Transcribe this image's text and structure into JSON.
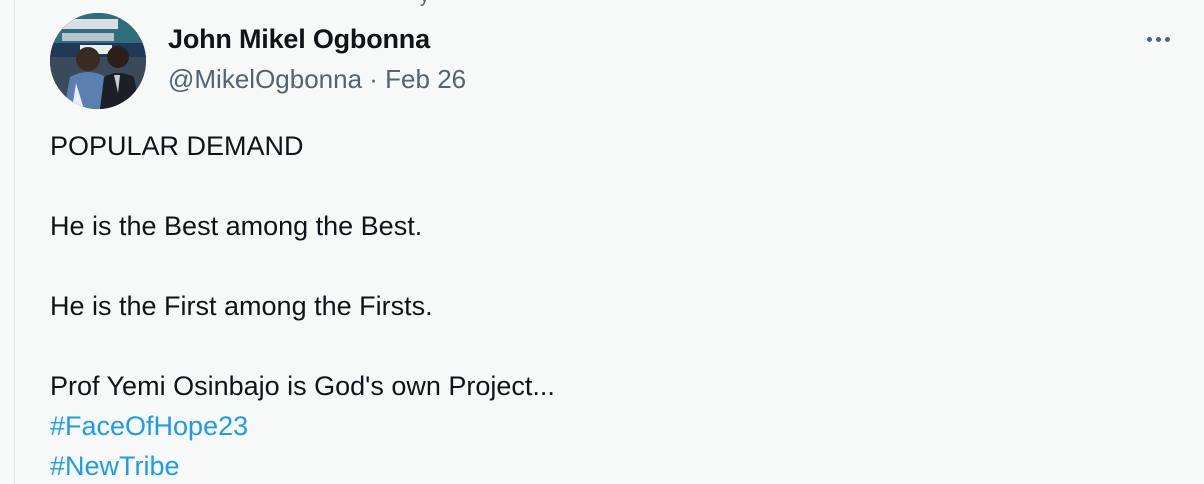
{
  "tweet": {
    "author": {
      "display_name": "John Mikel Ogbonna",
      "handle": "@MikelOgbonna",
      "separator": " · ",
      "date": "Feb 26"
    },
    "more_icon": "more-horizontal-icon",
    "text_lines": [
      "POPULAR DEMAND",
      "He is the Best among the Best.",
      "He is the First among the Firsts.",
      "Prof Yemi Osinbajo is God's own Project..."
    ],
    "hashtags": [
      "#FaceOfHope23",
      "#NewTribe"
    ],
    "colors": {
      "text": "#0f1419",
      "secondary": "#536471",
      "link": "#1d9bf0",
      "background": "#f7f9f9"
    }
  }
}
